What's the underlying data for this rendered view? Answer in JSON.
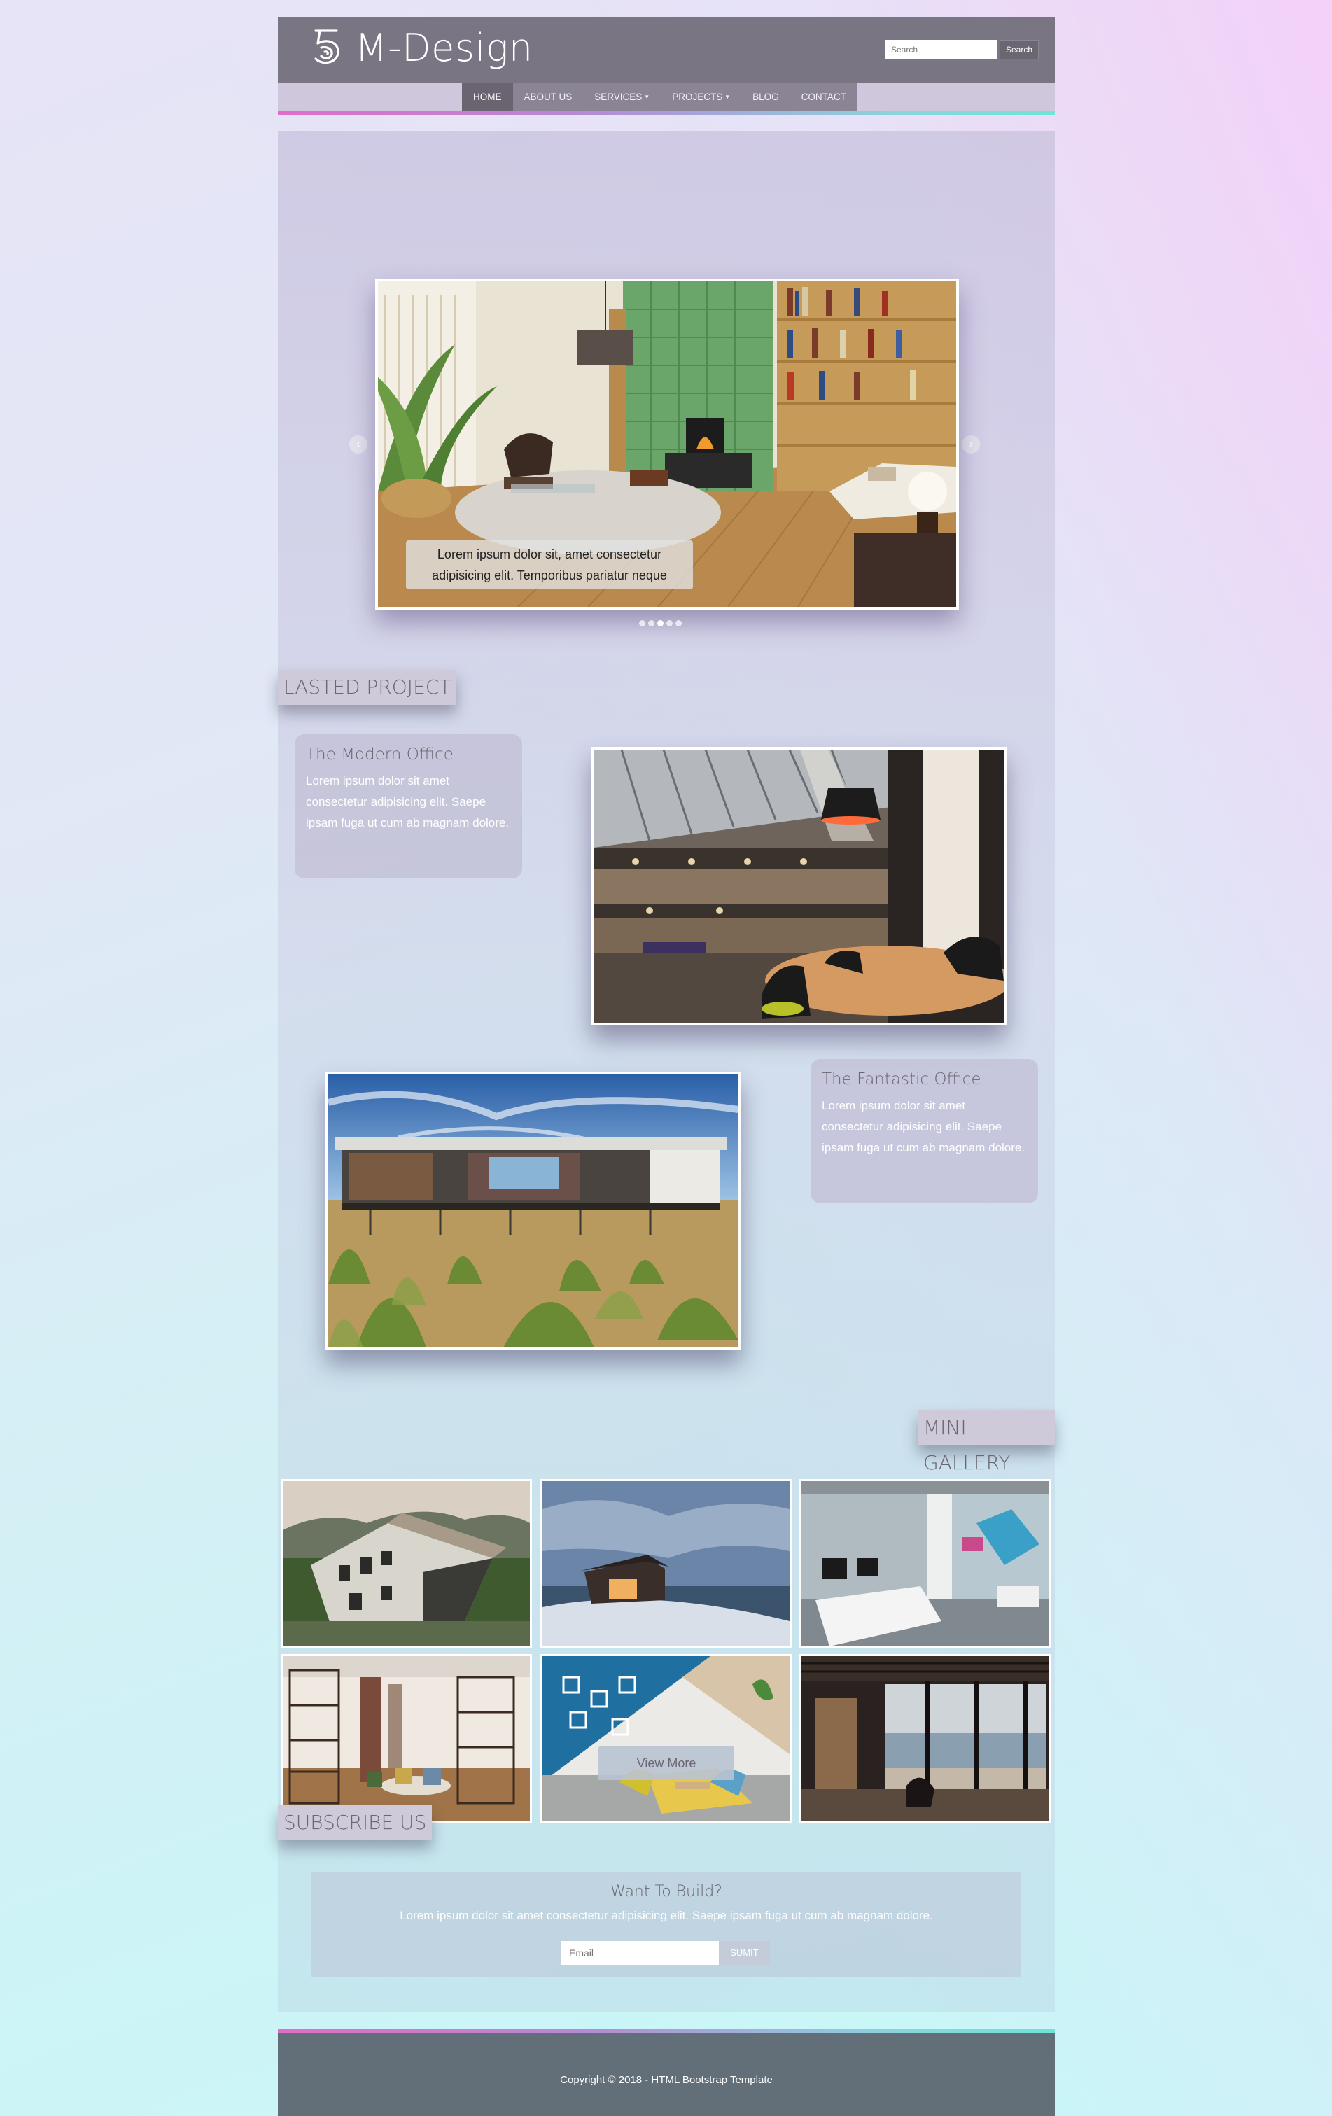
{
  "header": {
    "brand": "M-Design",
    "search_placeholder": "Search",
    "search_button": "Search"
  },
  "nav": {
    "items": [
      {
        "label": "HOME",
        "active": true
      },
      {
        "label": "ABOUT US"
      },
      {
        "label": "SERVICES",
        "dropdown": true
      },
      {
        "label": "PROJECTS",
        "dropdown": true
      },
      {
        "label": "BLOG"
      },
      {
        "label": "CONTACT"
      }
    ]
  },
  "carousel": {
    "caption_line1": "Lorem ipsum dolor sit, amet consectetur",
    "caption_line2": "adipisicing elit. Temporibus pariatur neque",
    "slide_count": 5,
    "active_index": 2
  },
  "sections": {
    "latest_project": "LASTED PROJECT",
    "mini_gallery": "MINI GALLERY",
    "subscribe": "SUBSCRIBE US"
  },
  "projects": [
    {
      "title": "The Modern Office",
      "text": "Lorem ipsum dolor sit amet consectetur adipisicing elit. Saepe ipsam fuga ut cum ab magnam dolore."
    },
    {
      "title": "The Fantastic Office",
      "text": "Lorem ipsum dolor sit amet consectetur adipisicing elit. Saepe ipsam fuga ut cum ab magnam dolore."
    }
  ],
  "gallery": {
    "view_more": "View More"
  },
  "subscribe": {
    "title": "Want To Build?",
    "text": "Lorem ipsum dolor sit amet consectetur adipisicing elit. Saepe ipsam fuga ut cum ab magnam dolore.",
    "email_placeholder": "Email",
    "submit_label": "SUMIT"
  },
  "footer": {
    "copyright": "Copyright © 2018 - HTML Bootstrap Template"
  },
  "colors": {
    "header_bg": "#7a7582",
    "nav_active": "#696470",
    "footer_bg": "#626f78",
    "accent_pink": "#e06dc9",
    "accent_teal": "#6fe4d7"
  }
}
